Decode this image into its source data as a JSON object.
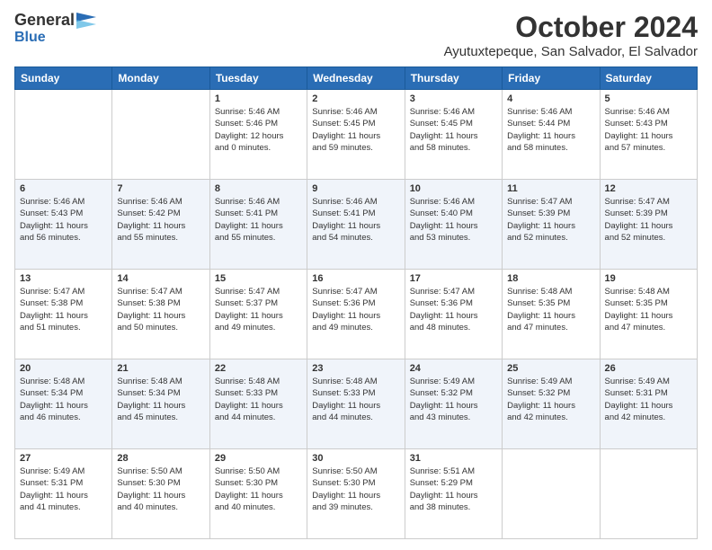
{
  "header": {
    "logo_general": "General",
    "logo_blue": "Blue",
    "month_title": "October 2024",
    "location": "Ayutuxtepeque, San Salvador, El Salvador"
  },
  "days_of_week": [
    "Sunday",
    "Monday",
    "Tuesday",
    "Wednesday",
    "Thursday",
    "Friday",
    "Saturday"
  ],
  "weeks": [
    [
      {
        "day": "",
        "info": ""
      },
      {
        "day": "",
        "info": ""
      },
      {
        "day": "1",
        "info": "Sunrise: 5:46 AM\nSunset: 5:46 PM\nDaylight: 12 hours\nand 0 minutes."
      },
      {
        "day": "2",
        "info": "Sunrise: 5:46 AM\nSunset: 5:45 PM\nDaylight: 11 hours\nand 59 minutes."
      },
      {
        "day": "3",
        "info": "Sunrise: 5:46 AM\nSunset: 5:45 PM\nDaylight: 11 hours\nand 58 minutes."
      },
      {
        "day": "4",
        "info": "Sunrise: 5:46 AM\nSunset: 5:44 PM\nDaylight: 11 hours\nand 58 minutes."
      },
      {
        "day": "5",
        "info": "Sunrise: 5:46 AM\nSunset: 5:43 PM\nDaylight: 11 hours\nand 57 minutes."
      }
    ],
    [
      {
        "day": "6",
        "info": "Sunrise: 5:46 AM\nSunset: 5:43 PM\nDaylight: 11 hours\nand 56 minutes."
      },
      {
        "day": "7",
        "info": "Sunrise: 5:46 AM\nSunset: 5:42 PM\nDaylight: 11 hours\nand 55 minutes."
      },
      {
        "day": "8",
        "info": "Sunrise: 5:46 AM\nSunset: 5:41 PM\nDaylight: 11 hours\nand 55 minutes."
      },
      {
        "day": "9",
        "info": "Sunrise: 5:46 AM\nSunset: 5:41 PM\nDaylight: 11 hours\nand 54 minutes."
      },
      {
        "day": "10",
        "info": "Sunrise: 5:46 AM\nSunset: 5:40 PM\nDaylight: 11 hours\nand 53 minutes."
      },
      {
        "day": "11",
        "info": "Sunrise: 5:47 AM\nSunset: 5:39 PM\nDaylight: 11 hours\nand 52 minutes."
      },
      {
        "day": "12",
        "info": "Sunrise: 5:47 AM\nSunset: 5:39 PM\nDaylight: 11 hours\nand 52 minutes."
      }
    ],
    [
      {
        "day": "13",
        "info": "Sunrise: 5:47 AM\nSunset: 5:38 PM\nDaylight: 11 hours\nand 51 minutes."
      },
      {
        "day": "14",
        "info": "Sunrise: 5:47 AM\nSunset: 5:38 PM\nDaylight: 11 hours\nand 50 minutes."
      },
      {
        "day": "15",
        "info": "Sunrise: 5:47 AM\nSunset: 5:37 PM\nDaylight: 11 hours\nand 49 minutes."
      },
      {
        "day": "16",
        "info": "Sunrise: 5:47 AM\nSunset: 5:36 PM\nDaylight: 11 hours\nand 49 minutes."
      },
      {
        "day": "17",
        "info": "Sunrise: 5:47 AM\nSunset: 5:36 PM\nDaylight: 11 hours\nand 48 minutes."
      },
      {
        "day": "18",
        "info": "Sunrise: 5:48 AM\nSunset: 5:35 PM\nDaylight: 11 hours\nand 47 minutes."
      },
      {
        "day": "19",
        "info": "Sunrise: 5:48 AM\nSunset: 5:35 PM\nDaylight: 11 hours\nand 47 minutes."
      }
    ],
    [
      {
        "day": "20",
        "info": "Sunrise: 5:48 AM\nSunset: 5:34 PM\nDaylight: 11 hours\nand 46 minutes."
      },
      {
        "day": "21",
        "info": "Sunrise: 5:48 AM\nSunset: 5:34 PM\nDaylight: 11 hours\nand 45 minutes."
      },
      {
        "day": "22",
        "info": "Sunrise: 5:48 AM\nSunset: 5:33 PM\nDaylight: 11 hours\nand 44 minutes."
      },
      {
        "day": "23",
        "info": "Sunrise: 5:48 AM\nSunset: 5:33 PM\nDaylight: 11 hours\nand 44 minutes."
      },
      {
        "day": "24",
        "info": "Sunrise: 5:49 AM\nSunset: 5:32 PM\nDaylight: 11 hours\nand 43 minutes."
      },
      {
        "day": "25",
        "info": "Sunrise: 5:49 AM\nSunset: 5:32 PM\nDaylight: 11 hours\nand 42 minutes."
      },
      {
        "day": "26",
        "info": "Sunrise: 5:49 AM\nSunset: 5:31 PM\nDaylight: 11 hours\nand 42 minutes."
      }
    ],
    [
      {
        "day": "27",
        "info": "Sunrise: 5:49 AM\nSunset: 5:31 PM\nDaylight: 11 hours\nand 41 minutes."
      },
      {
        "day": "28",
        "info": "Sunrise: 5:50 AM\nSunset: 5:30 PM\nDaylight: 11 hours\nand 40 minutes."
      },
      {
        "day": "29",
        "info": "Sunrise: 5:50 AM\nSunset: 5:30 PM\nDaylight: 11 hours\nand 40 minutes."
      },
      {
        "day": "30",
        "info": "Sunrise: 5:50 AM\nSunset: 5:30 PM\nDaylight: 11 hours\nand 39 minutes."
      },
      {
        "day": "31",
        "info": "Sunrise: 5:51 AM\nSunset: 5:29 PM\nDaylight: 11 hours\nand 38 minutes."
      },
      {
        "day": "",
        "info": ""
      },
      {
        "day": "",
        "info": ""
      }
    ]
  ]
}
